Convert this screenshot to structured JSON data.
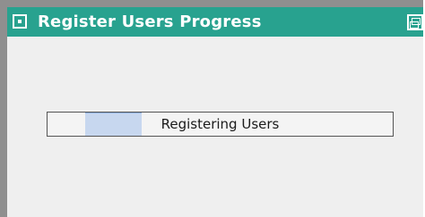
{
  "window": {
    "title": "Register Users Progress",
    "controls": {
      "close_icon": "window-close-icon",
      "restore_icon": "window-restore-icon"
    },
    "colors": {
      "titlebar": "#28a28f",
      "progress_fill": "#c7d7ef"
    }
  },
  "progress": {
    "label": "Registering Users",
    "percent": 27
  }
}
